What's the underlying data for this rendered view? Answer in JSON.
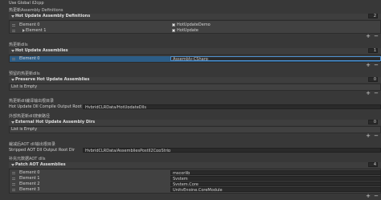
{
  "top_label": "Use Global il2cpp",
  "sections": {
    "assembly_defs": {
      "title": "热更新Assembly Definitions",
      "header": "Hot Update Assembly Definitions",
      "count": "2",
      "items": [
        {
          "label": "Element 0",
          "value": "HotUpdateDemo"
        },
        {
          "label": "Element 1",
          "value": "HotUpdate"
        }
      ]
    },
    "dlls": {
      "title": "热更新dlls",
      "header": "Hot Update Assemblies",
      "count": "1",
      "items": [
        {
          "label": "Element 0",
          "value": "Assembly-CSharp"
        }
      ]
    },
    "preserve": {
      "title": "预留的热更新dlls",
      "header": "Preserve Hot Update Assemblies",
      "count": "0",
      "empty": "List is Empty"
    },
    "output_dir": {
      "title": "热更新dll编译输出根目录",
      "label": "Hot Update Dll Compile Output Root Dir",
      "value": "HybridCLRData/HotUpdateDlls"
    },
    "external": {
      "title": "外部热更新dll搜索路径",
      "header": "External Hot Update Assembly Dirs",
      "count": "0",
      "empty": "List is Empty"
    },
    "stripped": {
      "title": "裁减后AOT dll输出根目录",
      "label": "Stripped AOT Dll Output Root Dir",
      "value": "HybridCLRData/AssembliesPostIl2CppStrip"
    },
    "patch": {
      "title": "补充元数据AOT dlls",
      "header": "Patch AOT Assemblies",
      "count": "4",
      "items": [
        {
          "label": "Element 0",
          "value": "mscorlib"
        },
        {
          "label": "Element 1",
          "value": "System"
        },
        {
          "label": "Element 2",
          "value": "System.Core"
        },
        {
          "label": "Element 3",
          "value": "UnityEngine.CoreModule"
        }
      ]
    }
  },
  "buttons": {
    "plus": "+",
    "minus": "−"
  }
}
